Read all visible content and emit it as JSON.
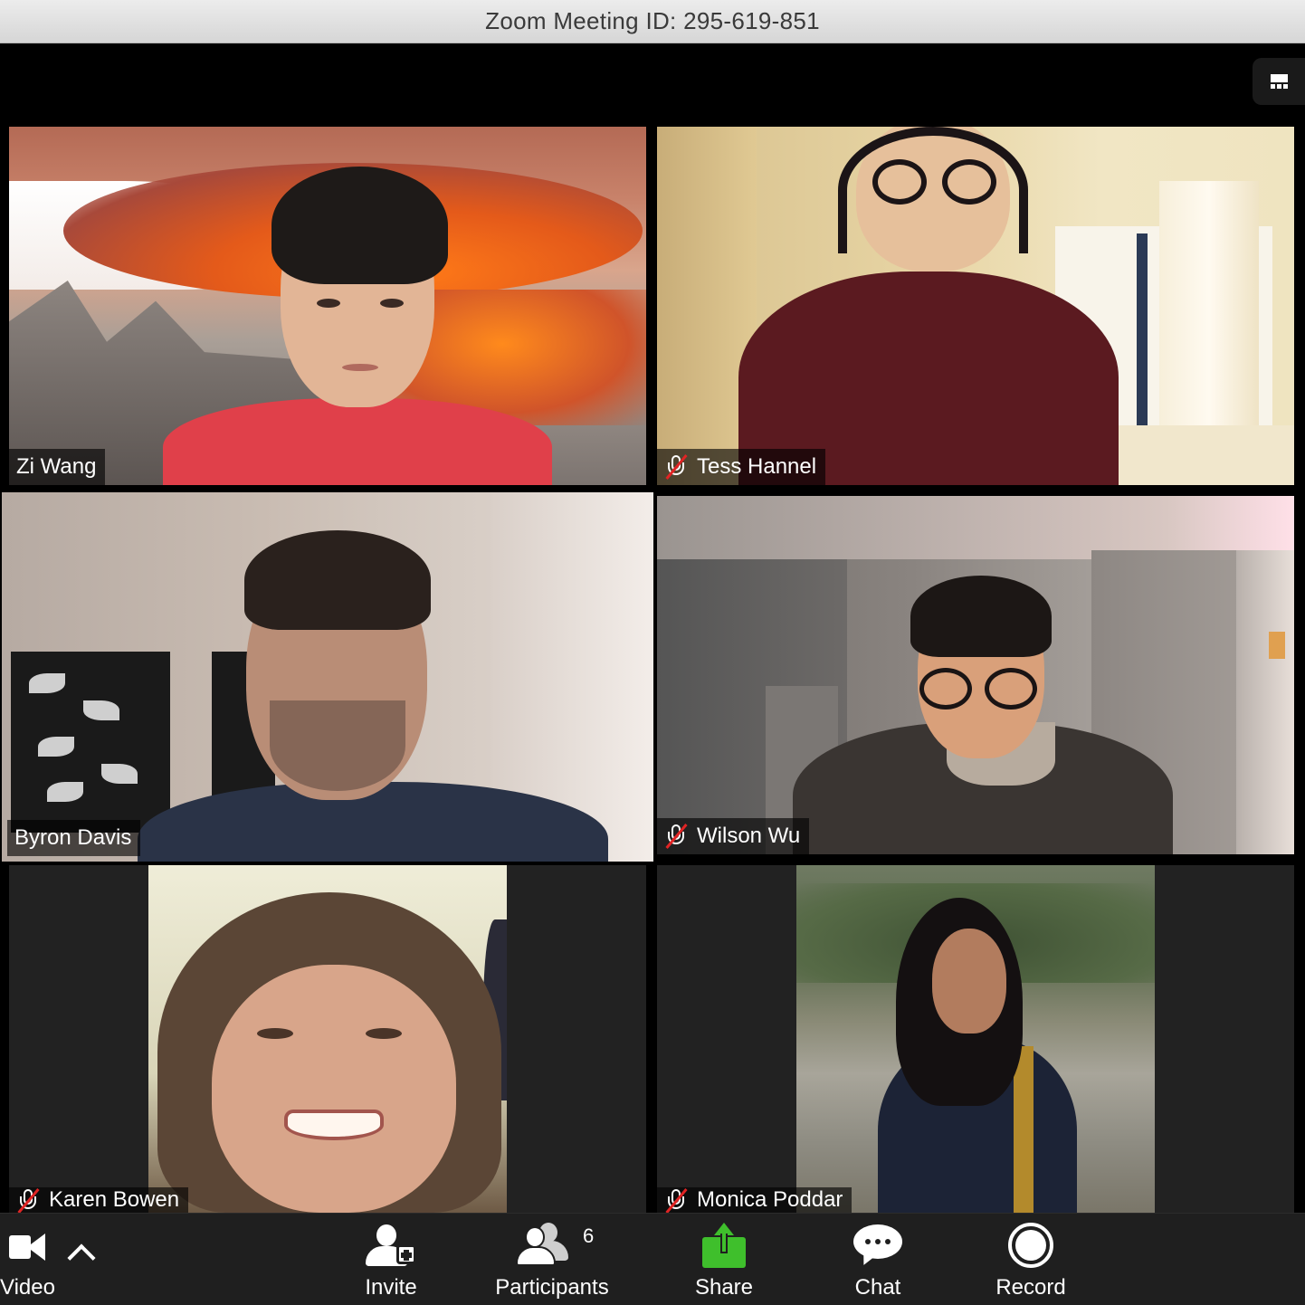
{
  "window": {
    "title": "Zoom Meeting ID: 295-619-851"
  },
  "view_toggle": {
    "icon": "gallery-view-icon"
  },
  "participants": [
    {
      "name": "Zi Wang",
      "muted": false,
      "active_speaker": false
    },
    {
      "name": "Tess Hannel",
      "muted": true,
      "active_speaker": false
    },
    {
      "name": "Byron Davis",
      "muted": false,
      "active_speaker": true
    },
    {
      "name": "Wilson Wu",
      "muted": true,
      "active_speaker": false
    },
    {
      "name": "Karen Bowen",
      "muted": true,
      "active_speaker": false
    },
    {
      "name": "Monica Poddar",
      "muted": true,
      "active_speaker": false
    }
  ],
  "toolbar": {
    "video_label": "Video",
    "invite_label": "Invite",
    "participants_label": "Participants",
    "participants_count": "6",
    "share_label": "Share",
    "chat_label": "Chat",
    "record_label": "Record"
  },
  "colors": {
    "active_speaker_border": "#c9e84a",
    "share_green": "#3fbf2c",
    "mute_slash": "#e02424"
  }
}
